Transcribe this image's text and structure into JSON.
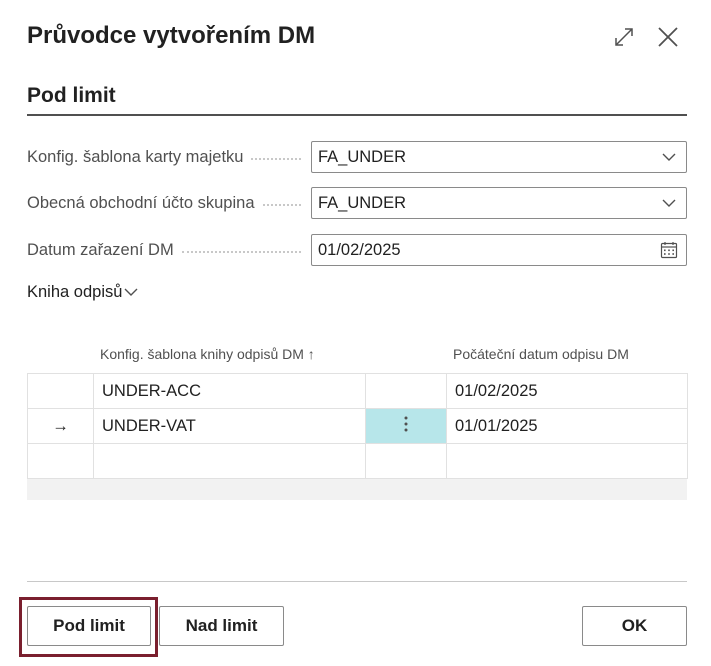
{
  "dialog": {
    "title": "Průvodce vytvořením DM",
    "expand_icon": "expand-icon",
    "close_icon": "close-icon"
  },
  "section": {
    "title": "Pod limit"
  },
  "fields": [
    {
      "label": "Konfig. šablona karty majetku",
      "value": "FA_UNDER",
      "icon": "chevron-down-icon"
    },
    {
      "label": "Obecná obchodní účto skupina",
      "value": "FA_UNDER",
      "icon": "chevron-down-icon"
    },
    {
      "label": "Datum zařazení DM",
      "value": "01/02/2025",
      "icon": "calendar-icon"
    }
  ],
  "depreciation_book": {
    "fasttab_label": "Kniha odpisů",
    "columns": {
      "template": "Konfig. šablona knihy odpisů DM",
      "start_date": "Počáteční datum odpisu DM"
    },
    "sort_indicator": "↑",
    "rows": [
      {
        "selected": false,
        "template": "UNDER-ACC",
        "start_date": "01/02/2025"
      },
      {
        "selected": true,
        "row_marker": "→",
        "template": "UNDER-VAT",
        "start_date": "01/01/2025"
      },
      {
        "selected": false,
        "template": "",
        "start_date": ""
      }
    ]
  },
  "footer": {
    "pod_limit_label": "Pod limit",
    "nad_limit_label": "Nad limit",
    "ok_label": "OK"
  },
  "colors": {
    "accent_focus": "#7a1f2e",
    "active_cell": "#b7e6ea"
  }
}
